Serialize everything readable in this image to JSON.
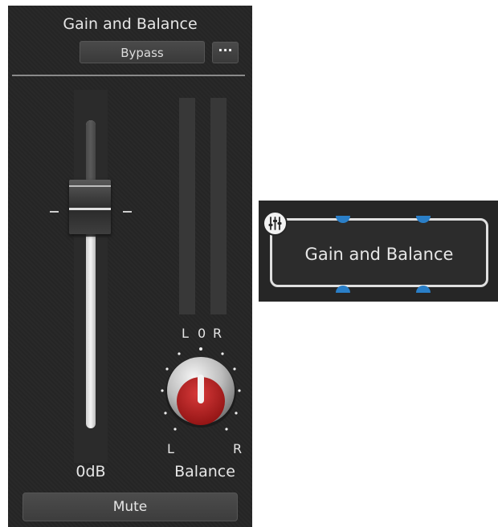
{
  "panel": {
    "title": "Gain and Balance",
    "bypass_label": "Bypass",
    "more_label": "···",
    "fader": {
      "value_label": "0dB"
    },
    "balance": {
      "label": "Balance",
      "top_left": "L",
      "top_center": "0",
      "top_right": "R",
      "bottom_left": "L",
      "bottom_right": "R"
    },
    "mute_label": "Mute"
  },
  "node": {
    "title": "Gain and Balance",
    "icon": "sliders-icon"
  },
  "colors": {
    "panel_bg": "#262626",
    "knob_red": "#b71c1c",
    "port_blue": "#2a7fc8"
  }
}
